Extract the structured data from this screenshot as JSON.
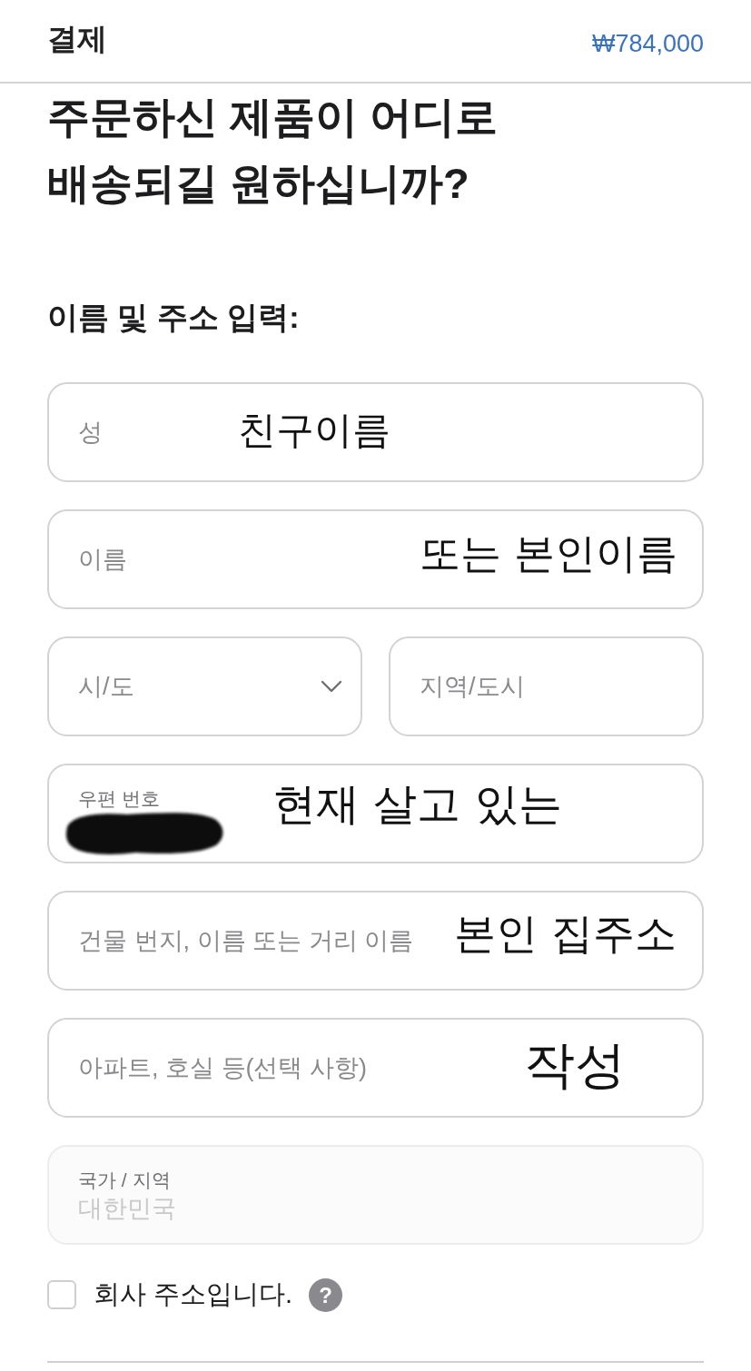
{
  "header": {
    "title": "결제",
    "total": "₩784,000"
  },
  "heading": "주문하신 제품이 어디로\n배송되길 원하십니까?",
  "section_label": "이름 및 주소 입력:",
  "form_rows": [
    {
      "fields": [
        {
          "kind": "text",
          "placeholder": "성",
          "disabled": false,
          "handwritten_note": "친구이름"
        }
      ]
    },
    {
      "fields": [
        {
          "kind": "text",
          "placeholder": "이름",
          "disabled": false,
          "handwritten_note": "또는 본인이름"
        }
      ]
    },
    {
      "fields": [
        {
          "kind": "select",
          "placeholder": "시/도",
          "disabled": false
        },
        {
          "kind": "text",
          "placeholder": "지역/도시",
          "disabled": false
        }
      ]
    },
    {
      "fields": [
        {
          "kind": "labeled",
          "label": "우편 번호",
          "redacted": true,
          "disabled": false,
          "handwritten_note": "현재 살고 있는"
        }
      ]
    },
    {
      "fields": [
        {
          "kind": "text",
          "placeholder": "건물 번지, 이름 또는 거리 이름",
          "disabled": false,
          "handwritten_note": "본인 집주소"
        }
      ]
    },
    {
      "fields": [
        {
          "kind": "text",
          "placeholder": "아파트, 호실 등(선택 사항)",
          "disabled": false,
          "handwritten_note": "작성"
        }
      ]
    },
    {
      "fields": [
        {
          "kind": "labeled",
          "label": "국가 / 지역",
          "value": "대한민국",
          "redacted": false,
          "disabled": true
        }
      ]
    }
  ],
  "company_checkbox": {
    "label": "회사 주소입니다.",
    "checked": false,
    "help": "?"
  }
}
